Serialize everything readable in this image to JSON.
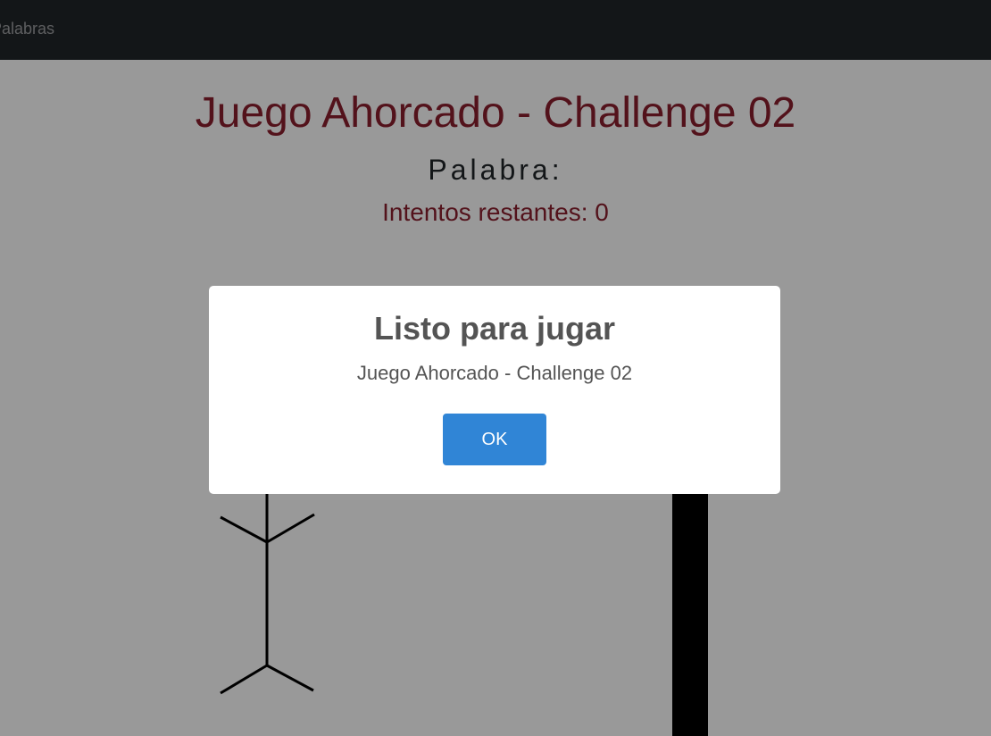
{
  "navbar": {
    "link_label": "Palabras"
  },
  "main": {
    "title": "Juego Ahorcado - Challenge 02",
    "word_label": "Palabra:",
    "attempts_label": "Intentos restantes: 0"
  },
  "modal": {
    "title": "Listo para jugar",
    "text": "Juego Ahorcado - Challenge 02",
    "ok_label": "OK"
  },
  "colors": {
    "accent_red": "#8b1e2d",
    "button_blue": "#3085d6",
    "navbar_bg": "#212529"
  }
}
